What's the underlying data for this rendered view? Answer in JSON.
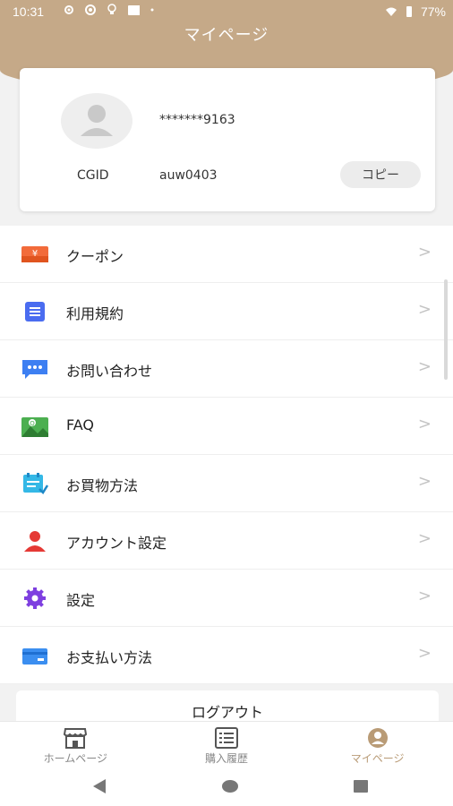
{
  "status_bar": {
    "time": "10:31",
    "battery": "77%"
  },
  "header": {
    "title": "マイページ"
  },
  "profile": {
    "account_masked": "*******9163",
    "cgid_label": "CGID",
    "cgid_value": "auw0403",
    "copy_label": "コピー"
  },
  "menu": {
    "items": [
      {
        "label": "クーポン",
        "icon": "coupon-icon",
        "color": "#f26b3a"
      },
      {
        "label": "利用規約",
        "icon": "document-icon",
        "color": "#4a6cf0"
      },
      {
        "label": "お問い合わせ",
        "icon": "chat-icon",
        "color": "#3d7ff2"
      },
      {
        "label": "FAQ",
        "icon": "faq-icon",
        "color": "#4caf50"
      },
      {
        "label": "お買物方法",
        "icon": "shopping-guide-icon",
        "color": "#34b8e6"
      },
      {
        "label": "アカウント設定",
        "icon": "person-icon",
        "color": "#e53935"
      },
      {
        "label": "設定",
        "icon": "gear-icon",
        "color": "#7e3fe0"
      },
      {
        "label": "お支払い方法",
        "icon": "card-icon",
        "color": "#3b8ef0"
      }
    ],
    "chevron": ">"
  },
  "logout_label": "ログアウト",
  "bottom_nav": {
    "home": "ホームページ",
    "history": "購入履歴",
    "mypage": "マイページ"
  },
  "colors": {
    "accent": "#c5a988",
    "active_tab": "#b99b76"
  }
}
